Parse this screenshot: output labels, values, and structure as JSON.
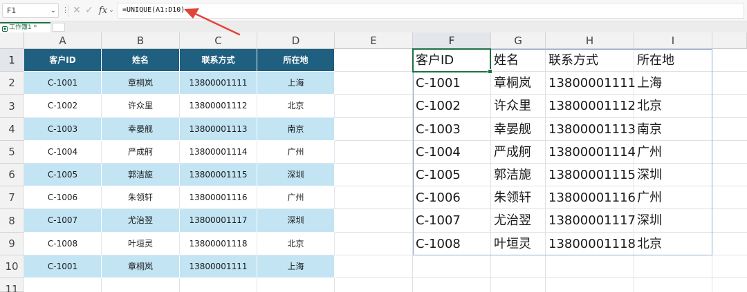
{
  "formula_bar": {
    "cell_ref": "F1",
    "formula": "=UNIQUE(A1:D10)"
  },
  "sheet": {
    "tab_name": "工作簿1 *"
  },
  "grid": {
    "columns": [
      "A",
      "B",
      "C",
      "D",
      "E",
      "F",
      "G",
      "H",
      "I"
    ],
    "rows": [
      "1",
      "2",
      "3",
      "4",
      "5",
      "6",
      "7",
      "8",
      "9",
      "10",
      "11"
    ],
    "selected_column": "F",
    "selected_row": "1"
  },
  "source_table": {
    "headers": [
      "客户ID",
      "姓名",
      "联系方式",
      "所在地"
    ],
    "rows": [
      [
        "C-1001",
        "章桐岚",
        "13800001111",
        "上海"
      ],
      [
        "C-1002",
        "许众里",
        "13800001112",
        "北京"
      ],
      [
        "C-1003",
        "幸晏舰",
        "13800001113",
        "南京"
      ],
      [
        "C-1004",
        "严成舸",
        "13800001114",
        "广州"
      ],
      [
        "C-1005",
        "郭洁旎",
        "13800001115",
        "深圳"
      ],
      [
        "C-1006",
        "朱领轩",
        "13800001116",
        "广州"
      ],
      [
        "C-1007",
        "尤治翌",
        "13800001117",
        "深圳"
      ],
      [
        "C-1008",
        "叶垣灵",
        "13800001118",
        "北京"
      ],
      [
        "C-1001",
        "章桐岚",
        "13800001111",
        "上海"
      ]
    ]
  },
  "unique_result": {
    "headers": [
      "客户ID",
      "姓名",
      "联系方式",
      "所在地"
    ],
    "rows": [
      [
        "C-1001",
        "章桐岚",
        "13800001111",
        "上海"
      ],
      [
        "C-1002",
        "许众里",
        "13800001112",
        "北京"
      ],
      [
        "C-1003",
        "幸晏舰",
        "13800001113",
        "南京"
      ],
      [
        "C-1004",
        "严成舸",
        "13800001114",
        "广州"
      ],
      [
        "C-1005",
        "郭洁旎",
        "13800001115",
        "深圳"
      ],
      [
        "C-1006",
        "朱领轩",
        "13800001116",
        "广州"
      ],
      [
        "C-1007",
        "尤治翌",
        "13800001117",
        "深圳"
      ],
      [
        "C-1008",
        "叶垣灵",
        "13800001118",
        "北京"
      ]
    ]
  },
  "colors": {
    "header_fill": "#1f5f80",
    "band_fill": "#c2e4f3",
    "selection_green": "#1d7044",
    "annotation_arrow": "#e0453a"
  }
}
